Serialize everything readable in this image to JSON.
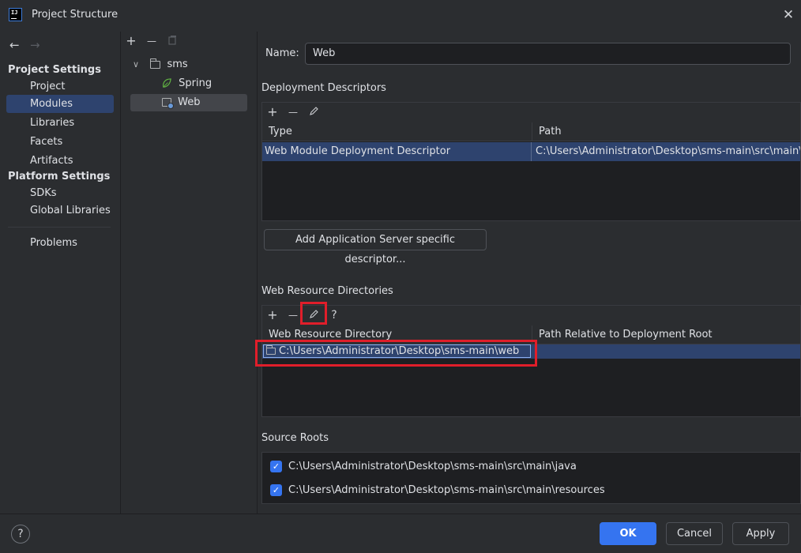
{
  "window": {
    "logo_text": "IJ",
    "title": "Project Structure",
    "close_glyph": "✕"
  },
  "nav": {
    "back_glyph": "←",
    "forward_glyph": "→",
    "project_settings_title": "Project Settings",
    "project_settings_items": [
      "Project",
      "Modules",
      "Libraries",
      "Facets",
      "Artifacts"
    ],
    "selected_item": "Modules",
    "platform_settings_title": "Platform Settings",
    "platform_settings_items": [
      "SDKs",
      "Global Libraries"
    ],
    "problems_label": "Problems"
  },
  "tree": {
    "toolbar": {
      "add": "+",
      "remove": "—",
      "copy_icon": "copy-icon"
    },
    "root": {
      "chevron": "∨",
      "label": "sms"
    },
    "children": [
      {
        "label": "Spring",
        "icon": "spring-icon",
        "selected": false
      },
      {
        "label": "Web",
        "icon": "web-module-icon",
        "selected": true
      }
    ]
  },
  "facet": {
    "name_label": "Name:",
    "name_value": "Web",
    "deployment_descriptors": {
      "title": "Deployment Descriptors",
      "toolbar": {
        "add": "+",
        "remove": "—",
        "edit_icon": "pencil-icon"
      },
      "columns": [
        "Type",
        "Path"
      ],
      "rows": [
        {
          "type": "Web Module Deployment Descriptor",
          "path": "C:\\Users\\Administrator\\Desktop\\sms-main\\src\\main\\web"
        }
      ],
      "add_server_button": "Add Application Server specific descriptor..."
    },
    "web_resource_directories": {
      "title": "Web Resource Directories",
      "toolbar": {
        "add": "+",
        "remove": "—",
        "edit_icon": "pencil-icon",
        "help": "?"
      },
      "columns": [
        "Web Resource Directory",
        "Path Relative to Deployment Root"
      ],
      "rows": [
        {
          "directory": "C:\\Users\\Administrator\\Desktop\\sms-main\\web",
          "relative_path": ""
        }
      ]
    },
    "source_roots": {
      "title": "Source Roots",
      "items": [
        {
          "checked": true,
          "path": "C:\\Users\\Administrator\\Desktop\\sms-main\\src\\main\\java"
        },
        {
          "checked": true,
          "path": "C:\\Users\\Administrator\\Desktop\\sms-main\\src\\main\\resources"
        }
      ]
    }
  },
  "footer": {
    "help": "?",
    "ok_label": "OK",
    "cancel_label": "Cancel",
    "apply_label": "Apply"
  },
  "colors": {
    "background": "#2b2d30",
    "selection": "#2e436e",
    "accent": "#3574f0",
    "highlight_box": "#e01e2a"
  }
}
